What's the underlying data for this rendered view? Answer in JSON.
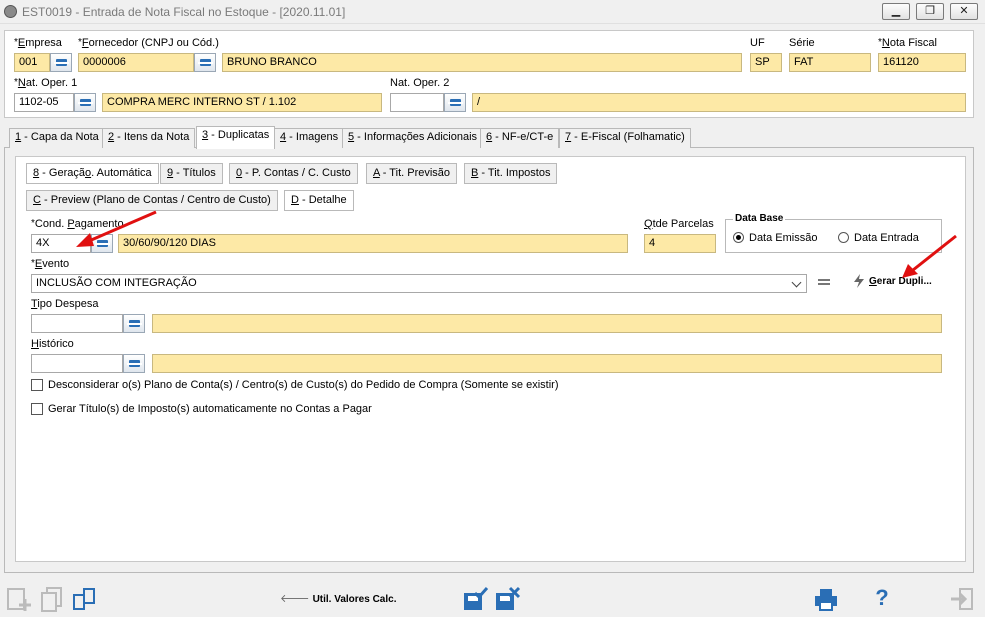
{
  "window": {
    "title": "EST0019 - Entrada de Nota Fiscal no Estoque - [2020.11.01]",
    "min_label": "▭",
    "max_label": "▢",
    "close_label": "✕"
  },
  "header": {
    "empresa_label_pre": "",
    "empresa_label_ul": "E",
    "empresa_label_post": "mpresa",
    "empresa_value": "001",
    "fornecedor_label_ul": "F",
    "fornecedor_label_post": "ornecedor (CNPJ ou Cód.)",
    "fornecedor_code": "0000006",
    "fornecedor_name": "BRUNO BRANCO",
    "uf_label": "UF",
    "uf_value": "SP",
    "serie_label": "Série",
    "serie_value": "FAT",
    "nota_label_ul": "N",
    "nota_label_post": "ota Fiscal",
    "nota_value": "161120",
    "natop1_label_ul": "N",
    "natop1_label_post": "at. Oper. 1",
    "natop1_code": "1102-05",
    "natop1_desc": "COMPRA MERC INTERNO ST / 1.102",
    "natop2_label": "Nat. Oper. 2",
    "natop2_code": "",
    "natop2_desc": "/"
  },
  "tabs": [
    {
      "key": "1",
      "label": " - Capa da Nota"
    },
    {
      "key": "2",
      "label": " - Itens da Nota"
    },
    {
      "key": "3",
      "label": " - Duplicatas"
    },
    {
      "key": "4",
      "label": " - Imagens"
    },
    {
      "key": "5",
      "label": " - Informações Adicionais"
    },
    {
      "key": "6",
      "label": " - NF-e/CT-e"
    },
    {
      "key": "7",
      "label": " - E-Fiscal (Folhamatic)"
    }
  ],
  "subtabs": [
    {
      "key": "8",
      "label": " - Geraçã",
      "key2": "o",
      "label2": ". Automática"
    },
    {
      "key": "9",
      "label": " - Títulos"
    },
    {
      "key": "0",
      "label": " - P. Contas / C. Custo"
    },
    {
      "key": "A",
      "label": " - Tit. Previsão"
    },
    {
      "key": "B",
      "label": " - Tit. Impostos"
    },
    {
      "key": "C",
      "label": " - Preview (Plano de Contas / Centro de Custo)"
    },
    {
      "key": "D",
      "label": " - Detalhe"
    }
  ],
  "form": {
    "cond_label_pre": "Cond. ",
    "cond_label_ul": "P",
    "cond_label_post": "agamento",
    "cond_code": "4X",
    "cond_desc": "30/60/90/120 DIAS",
    "qtde_label_ul": "Q",
    "qtde_label_post": "tde Parcelas",
    "qtde_value": "4",
    "data_base_label": "Data Base",
    "radio_emissao": "Data Emissão",
    "radio_entrada": "Data Entrada",
    "evento_label_ul": "E",
    "evento_label_post": "vento",
    "evento_value": "INCLUSÃO COM INTEGRAÇÃO",
    "gerar_label_ul": "G",
    "gerar_label_post": "erar Dupli...",
    "tipo_label_ul": "T",
    "tipo_label_post": "ipo Despesa",
    "tipo_code": "",
    "tipo_desc": "",
    "historico_label_ul": "H",
    "historico_label_post": "istórico",
    "historico_code": "",
    "historico_desc": "",
    "check1_label": "Desconsiderar o(s) Plano de Conta(s) / Centro(s) de Custo(s) do Pedido de Compra (Somente se existir)",
    "check2_label": "Gerar Título(s) de Imposto(s) automaticamente no Contas a Pagar"
  },
  "footer": {
    "util_label": "Util. Valores Calc."
  },
  "colors": {
    "field_yellow": "#fde9a6",
    "accent_blue": "#2a6eb5",
    "annotation_red": "#e01010"
  }
}
